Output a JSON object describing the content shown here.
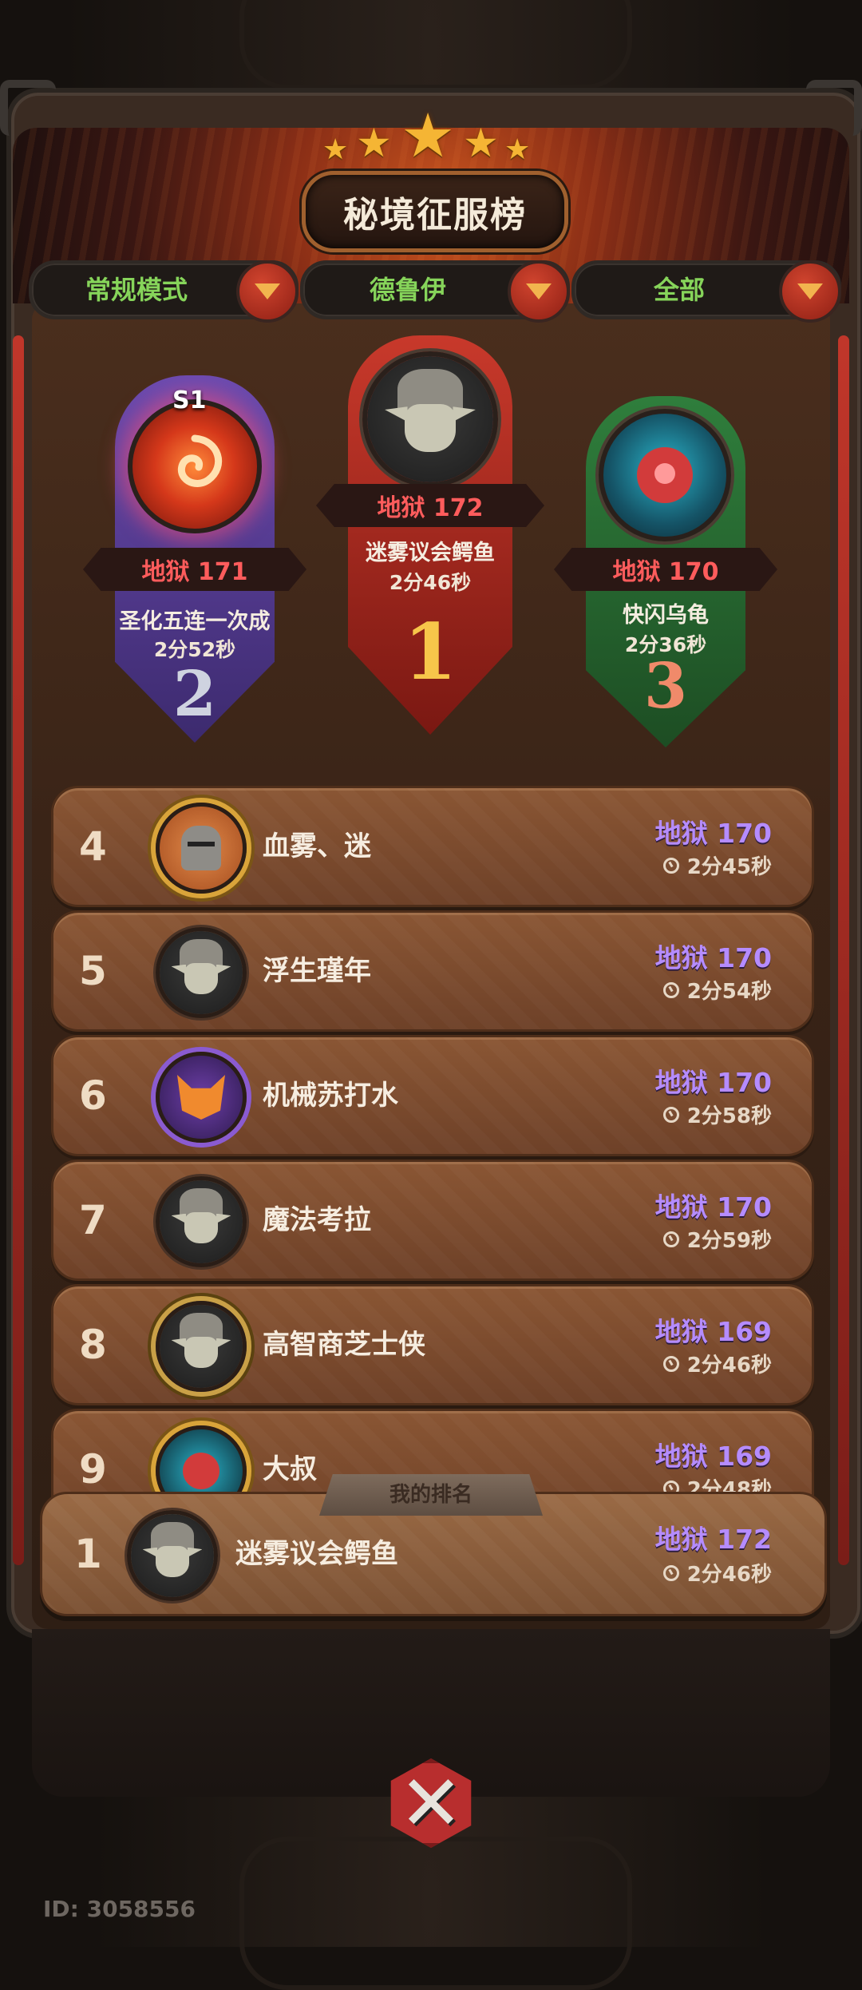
{
  "title": "秘境征服榜",
  "filters": [
    {
      "label": "常规模式"
    },
    {
      "label": "德鲁伊"
    },
    {
      "label": "全部"
    }
  ],
  "podium": {
    "first": {
      "rank": "1",
      "level": "地狱 172",
      "name": "迷雾议会鳄鱼",
      "time": "2分46秒"
    },
    "second": {
      "rank": "2",
      "level": "地狱 171",
      "name": "圣化五连一次成",
      "time": "2分52秒",
      "badge": "S1"
    },
    "third": {
      "rank": "3",
      "level": "地狱 170",
      "name": "快闪乌龟",
      "time": "2分36秒"
    }
  },
  "list": [
    {
      "rank": "4",
      "name": "血雾、迷",
      "level": "地狱 170",
      "time": "2分45秒",
      "avatar_icon": "knight-avatar-icon"
    },
    {
      "rank": "5",
      "name": "浮生瑾年",
      "level": "地狱 170",
      "time": "2分54秒",
      "avatar_icon": "elf-avatar-icon"
    },
    {
      "rank": "6",
      "name": "机械苏打水",
      "level": "地狱 170",
      "time": "2分58秒",
      "avatar_icon": "fox-avatar-icon"
    },
    {
      "rank": "7",
      "name": "魔法考拉",
      "level": "地狱 170",
      "time": "2分59秒",
      "avatar_icon": "elf-avatar-icon"
    },
    {
      "rank": "8",
      "name": "高智商芝士侠",
      "level": "地狱 169",
      "time": "2分46秒",
      "avatar_icon": "dragon-elf-avatar-icon"
    },
    {
      "rank": "9",
      "name": "大叔",
      "level": "地狱 169",
      "time": "2分48秒",
      "avatar_icon": "clown-avatar-icon"
    }
  ],
  "my_rank": {
    "tab_label": "我的排名",
    "rank": "1",
    "name": "迷雾议会鳄鱼",
    "level": "地狱 172",
    "time": "2分46秒"
  },
  "footer": {
    "id_text": "ID: 3058556"
  },
  "colors": {
    "level_purple": "#b58cff",
    "level_red": "#ff5c5c",
    "filter_green": "#86d45a",
    "star_gold": "#f5b534"
  }
}
